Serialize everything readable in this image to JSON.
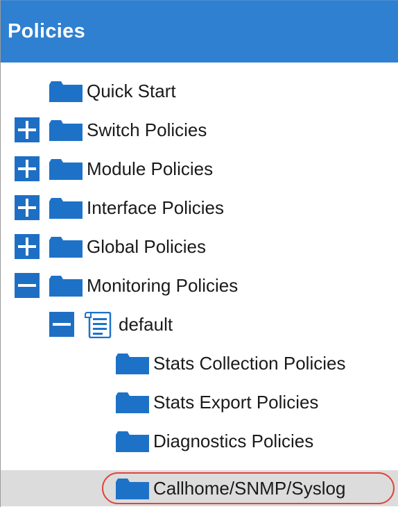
{
  "header": {
    "title": "Policies",
    "background_color": "#2f80d1"
  },
  "tree": {
    "items": [
      {
        "label": "Quick Start",
        "icon": "folder-icon",
        "toggle": "none",
        "depth": 1,
        "selected": false
      },
      {
        "label": "Switch Policies",
        "icon": "folder-icon",
        "toggle": "expand",
        "depth": 0,
        "selected": false
      },
      {
        "label": "Module Policies",
        "icon": "folder-icon",
        "toggle": "expand",
        "depth": 0,
        "selected": false
      },
      {
        "label": "Interface Policies",
        "icon": "folder-icon",
        "toggle": "expand",
        "depth": 0,
        "selected": false
      },
      {
        "label": "Global Policies",
        "icon": "folder-icon",
        "toggle": "expand",
        "depth": 0,
        "selected": false
      },
      {
        "label": "Monitoring Policies",
        "icon": "folder-icon",
        "toggle": "collapse",
        "depth": 0,
        "selected": false
      },
      {
        "label": "default",
        "icon": "document-icon",
        "toggle": "collapse",
        "depth": 1,
        "selected": false
      },
      {
        "label": "Stats Collection Policies",
        "icon": "folder-icon",
        "toggle": "none",
        "depth": 2,
        "selected": false
      },
      {
        "label": "Stats Export Policies",
        "icon": "folder-icon",
        "toggle": "none",
        "depth": 2,
        "selected": false
      },
      {
        "label": "Diagnostics Policies",
        "icon": "folder-icon",
        "toggle": "none",
        "depth": 2,
        "selected": false
      },
      {
        "label": "Callhome/SNMP/Syslog",
        "icon": "folder-icon",
        "toggle": "none",
        "depth": 2,
        "selected": true
      }
    ]
  },
  "colors": {
    "accent": "#1e6fc4",
    "folder": "#1d72c8",
    "selected_row": "#dcdcdc",
    "highlight_ring": "#e0453a"
  }
}
